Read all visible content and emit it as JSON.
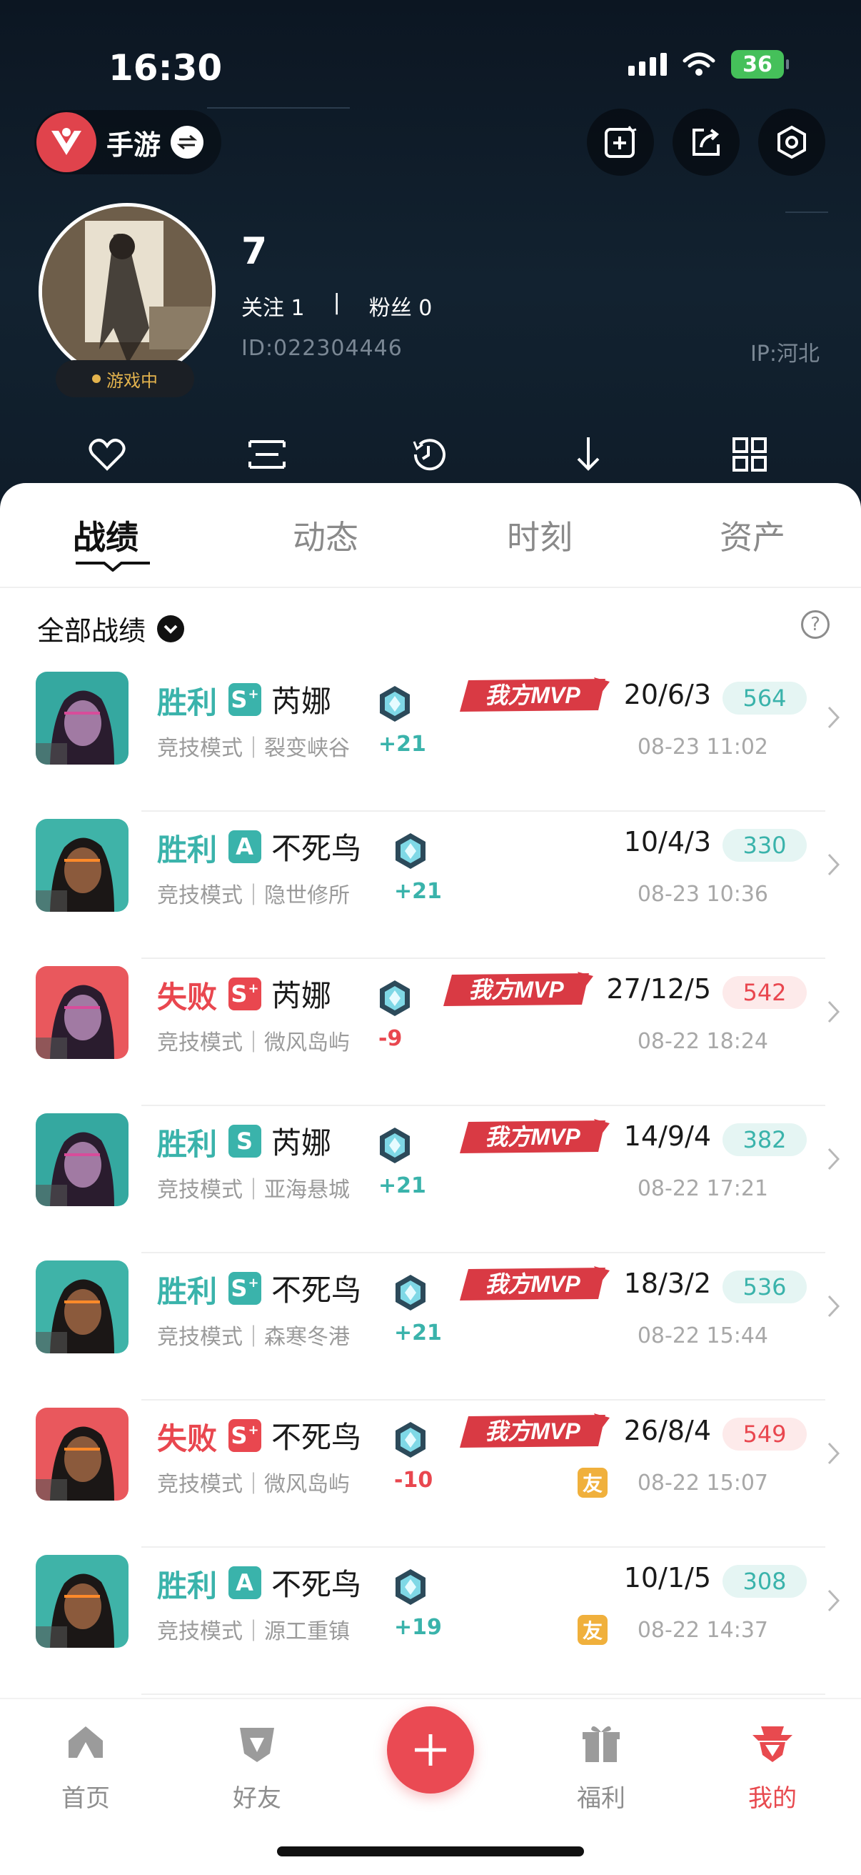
{
  "status_bar": {
    "time": "16:30",
    "battery": "36"
  },
  "game_switch": {
    "label": "手游"
  },
  "profile": {
    "name": "7",
    "following_label": "关注 1",
    "separator": "|",
    "fans_label": "粉丝 0",
    "id": "ID:022304446",
    "ip": "IP:河北",
    "status": "游戏中"
  },
  "tabs": [
    {
      "label": "战绩"
    },
    {
      "label": "动态"
    },
    {
      "label": "时刻"
    },
    {
      "label": "资产"
    }
  ],
  "filter": {
    "label": "全部战绩",
    "help": "?"
  },
  "matches": [
    {
      "result": "胜利",
      "outcome": "win",
      "rank": "S",
      "rank_plus": "+",
      "agent": "芮娜",
      "mode": "竞技模式｜裂变峡谷",
      "delta": "+21",
      "mvp": true,
      "kda": "20/6/3",
      "score": "564",
      "time": "08-23 11:02",
      "friend": false
    },
    {
      "result": "胜利",
      "outcome": "win",
      "rank": "A",
      "rank_plus": "",
      "agent": "不死鸟",
      "mode": "竞技模式｜隐世修所",
      "delta": "+21",
      "mvp": false,
      "kda": "10/4/3",
      "score": "330",
      "time": "08-23 10:36",
      "friend": false
    },
    {
      "result": "失败",
      "outcome": "lose",
      "rank": "S",
      "rank_plus": "+",
      "agent": "芮娜",
      "mode": "竞技模式｜微风岛屿",
      "delta": "-9",
      "mvp": true,
      "kda": "27/12/5",
      "score": "542",
      "time": "08-22 18:24",
      "friend": false
    },
    {
      "result": "胜利",
      "outcome": "win",
      "rank": "S",
      "rank_plus": "",
      "agent": "芮娜",
      "mode": "竞技模式｜亚海悬城",
      "delta": "+21",
      "mvp": true,
      "kda": "14/9/4",
      "score": "382",
      "time": "08-22 17:21",
      "friend": false
    },
    {
      "result": "胜利",
      "outcome": "win",
      "rank": "S",
      "rank_plus": "+",
      "agent": "不死鸟",
      "mode": "竞技模式｜森寒冬港",
      "delta": "+21",
      "mvp": true,
      "kda": "18/3/2",
      "score": "536",
      "time": "08-22 15:44",
      "friend": false
    },
    {
      "result": "失败",
      "outcome": "lose",
      "rank": "S",
      "rank_plus": "+",
      "agent": "不死鸟",
      "mode": "竞技模式｜微风岛屿",
      "delta": "-10",
      "mvp": true,
      "kda": "26/8/4",
      "score": "549",
      "time": "08-22 15:07",
      "friend": true
    },
    {
      "result": "胜利",
      "outcome": "win",
      "rank": "A",
      "rank_plus": "",
      "agent": "不死鸟",
      "mode": "竞技模式｜源工重镇",
      "delta": "+19",
      "mvp": false,
      "kda": "10/1/5",
      "score": "308",
      "time": "08-22 14:37",
      "friend": true
    }
  ],
  "mvp_label": "我方MVP",
  "friend_label": "友",
  "bottom_nav": [
    {
      "label": "首页"
    },
    {
      "label": "好友"
    },
    {
      "label": "福利"
    },
    {
      "label": "我的"
    }
  ],
  "colors": {
    "win": "#3ab3ab",
    "lose": "#e9474f",
    "accent": "#e84a4f",
    "header_bg": "#0f1c29"
  }
}
